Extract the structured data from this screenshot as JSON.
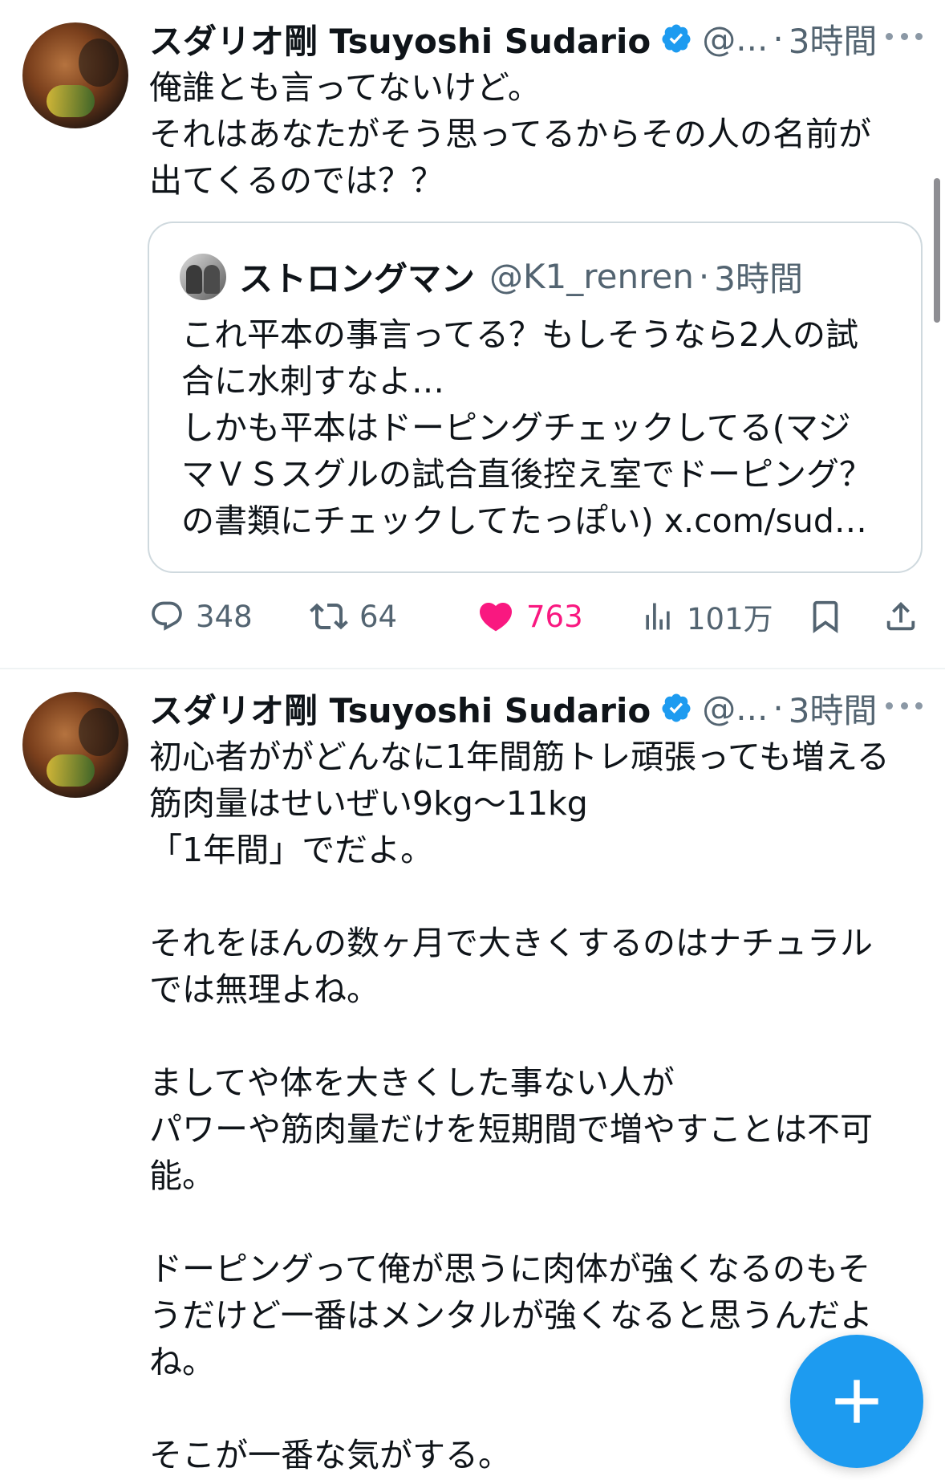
{
  "tweets": [
    {
      "author_name": "スダリオ剛 Tsuyoshi Sudario",
      "handle": "@...",
      "dot": "·",
      "time": "3時間",
      "text": "俺誰とも言ってないけど。\nそれはあなたがそう思ってるからその人の名前が\n出てくるのでは？？",
      "quote": {
        "author_name": "ストロングマン",
        "handle": "@K1_renren",
        "dot": "·",
        "time": "3時間",
        "text": "これ平本の事言ってる？もしそうなら2人の試\n合に水刺すなよ…\nしかも平本はドーピングチェックしてる(マジ\nマＶＳスグルの試合直後控え室でドーピング？\nの書類にチェックしてたっぽい) x.com/sud…"
      },
      "actions": {
        "replies": "348",
        "retweets": "64",
        "likes": "763",
        "views": "101万"
      }
    },
    {
      "author_name": "スダリオ剛 Tsuyoshi Sudario",
      "handle": "@...",
      "dot": "·",
      "time": "3時間",
      "text": "初心者ががどんなに1年間筋トレ頑張っても増える\n筋肉量はせいぜい9kg〜11kg\n「1年間」でだよ。\n\nそれをほんの数ヶ月で大きくするのはナチュラル\nでは無理よね。\n\nましてや体を大きくした事ない人が\nパワーや筋肉量だけを短期間で増やすことは不可\n能。\n\nドーピングって俺が思うに肉体が強くなるのもそ\nうだけど一番はメンタルが強くなると思うんだよ\nね。\n\nそこが一番な気がする。"
    }
  ],
  "colors": {
    "accent": "#1d9bf0",
    "like": "#f91880",
    "secondary_text": "#536471",
    "border": "#cfd9de"
  },
  "icons": {
    "verified": "verified-badge-icon",
    "more": "more-dots-icon",
    "reply": "reply-icon",
    "retweet": "retweet-icon",
    "like": "heart-icon",
    "views": "views-chart-icon",
    "bookmark": "bookmark-icon",
    "share": "share-icon",
    "compose": "plus-icon"
  }
}
